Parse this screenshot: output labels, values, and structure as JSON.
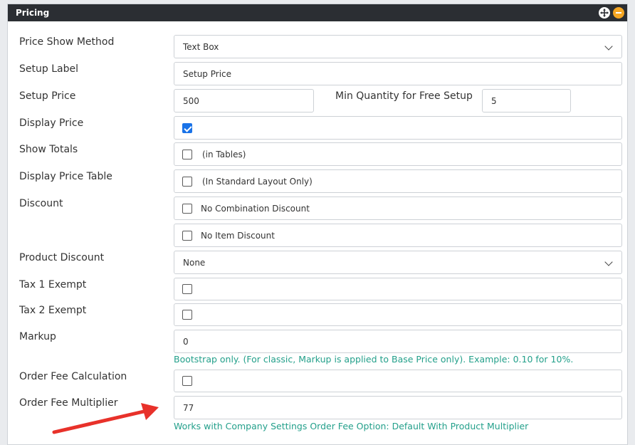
{
  "panel": {
    "title": "Pricing",
    "colors": {
      "header_bg": "#2b2e33",
      "collapse_button": "#f5a623",
      "help_text": "#24a08b",
      "arrow": "#e8312a",
      "checkbox_checked": "#1a73e8"
    }
  },
  "fields": {
    "price_show_method": {
      "label": "Price Show Method",
      "value": "Text Box"
    },
    "setup_label": {
      "label": "Setup Label",
      "value": "Setup Price"
    },
    "setup_price": {
      "label": "Setup Price",
      "value": "500"
    },
    "min_quantity": {
      "label": "Min Quantity for Free Setup",
      "value": "5"
    },
    "display_price": {
      "label": "Display Price",
      "checked": true
    },
    "show_totals": {
      "label": "Show Totals",
      "text": "(in Tables)",
      "checked": false
    },
    "display_price_table": {
      "label": "Display Price Table",
      "text": "(In Standard Layout Only)",
      "checked": false
    },
    "discount": {
      "label": "Discount",
      "options": [
        {
          "text": "No Combination Discount",
          "checked": false
        },
        {
          "text": "No Item Discount",
          "checked": false
        }
      ]
    },
    "product_discount": {
      "label": "Product Discount",
      "value": "None"
    },
    "tax1_exempt": {
      "label": "Tax 1 Exempt",
      "checked": false
    },
    "tax2_exempt": {
      "label": "Tax 2 Exempt",
      "checked": false
    },
    "markup": {
      "label": "Markup",
      "value": "0",
      "help": "Bootstrap only. (For classic, Markup is applied to Base Price only). Example: 0.10 for 10%."
    },
    "order_fee_calculation": {
      "label": "Order Fee Calculation",
      "checked": false
    },
    "order_fee_multiplier": {
      "label": "Order Fee Multiplier",
      "value": "77",
      "help": "Works with Company Settings Order Fee Option: Default With Product Multiplier"
    }
  },
  "icons": {
    "move": "move-icon",
    "collapse": "minus-icon",
    "dropdown": "chevron-down-icon",
    "annotation": "arrow-icon"
  }
}
